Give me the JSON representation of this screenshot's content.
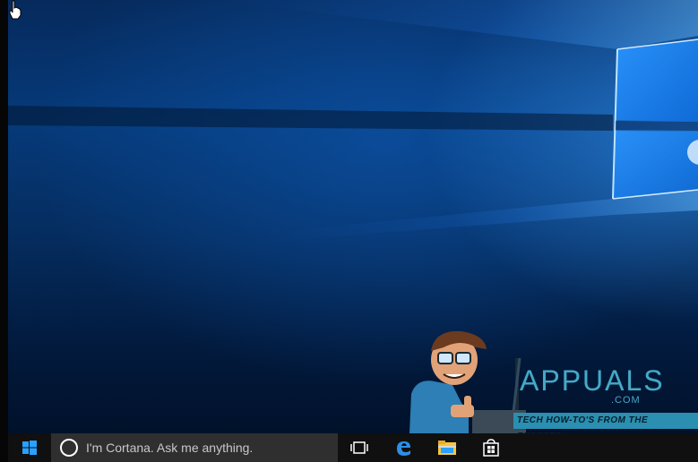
{
  "taskbar": {
    "search_placeholder": "I'm Cortana. Ask me anything.",
    "buttons": {
      "start": "windows-logo-icon",
      "task_view": "task-view-icon",
      "edge": "edge-icon",
      "file_explorer": "file-explorer-icon",
      "store": "store-icon"
    }
  },
  "watermark": {
    "brand": "APPUALS",
    "domain": ".COM",
    "tagline": "TECH HOW-TO'S FROM THE EXPERTS!"
  },
  "colors": {
    "taskbar": "#101010",
    "search_box": "#2f2f2f",
    "accent_blue": "#1e90ff",
    "watermark_teal": "#45a9c9"
  }
}
